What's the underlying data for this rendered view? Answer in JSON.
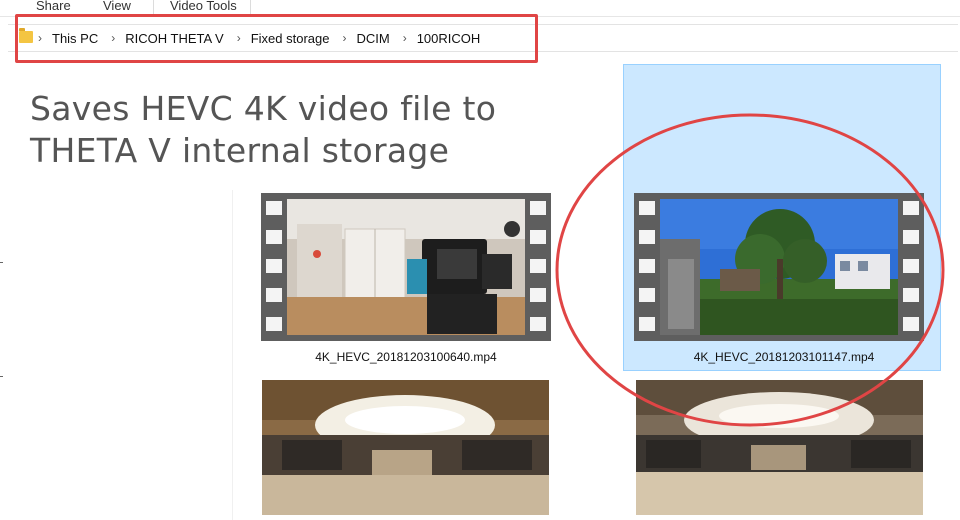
{
  "ribbon": {
    "tabs": [
      "Share",
      "View",
      "Video Tools"
    ]
  },
  "address_bar": {
    "crumbs": [
      "This PC",
      "RICOH THETA V",
      "Fixed storage",
      "DCIM",
      "100RICOH"
    ]
  },
  "caption": {
    "line1": "Saves HEVC 4K video file to",
    "line2": "THETA V internal storage"
  },
  "files": [
    {
      "name": "4K_HEVC_20181203100640.mp4",
      "selected": false
    },
    {
      "name": "4K_HEVC_20181203101147.mp4",
      "selected": true
    }
  ],
  "colors": {
    "annotation_red": "#e04545",
    "selection_fill": "#cce8ff",
    "selection_border": "#99d1ff"
  }
}
